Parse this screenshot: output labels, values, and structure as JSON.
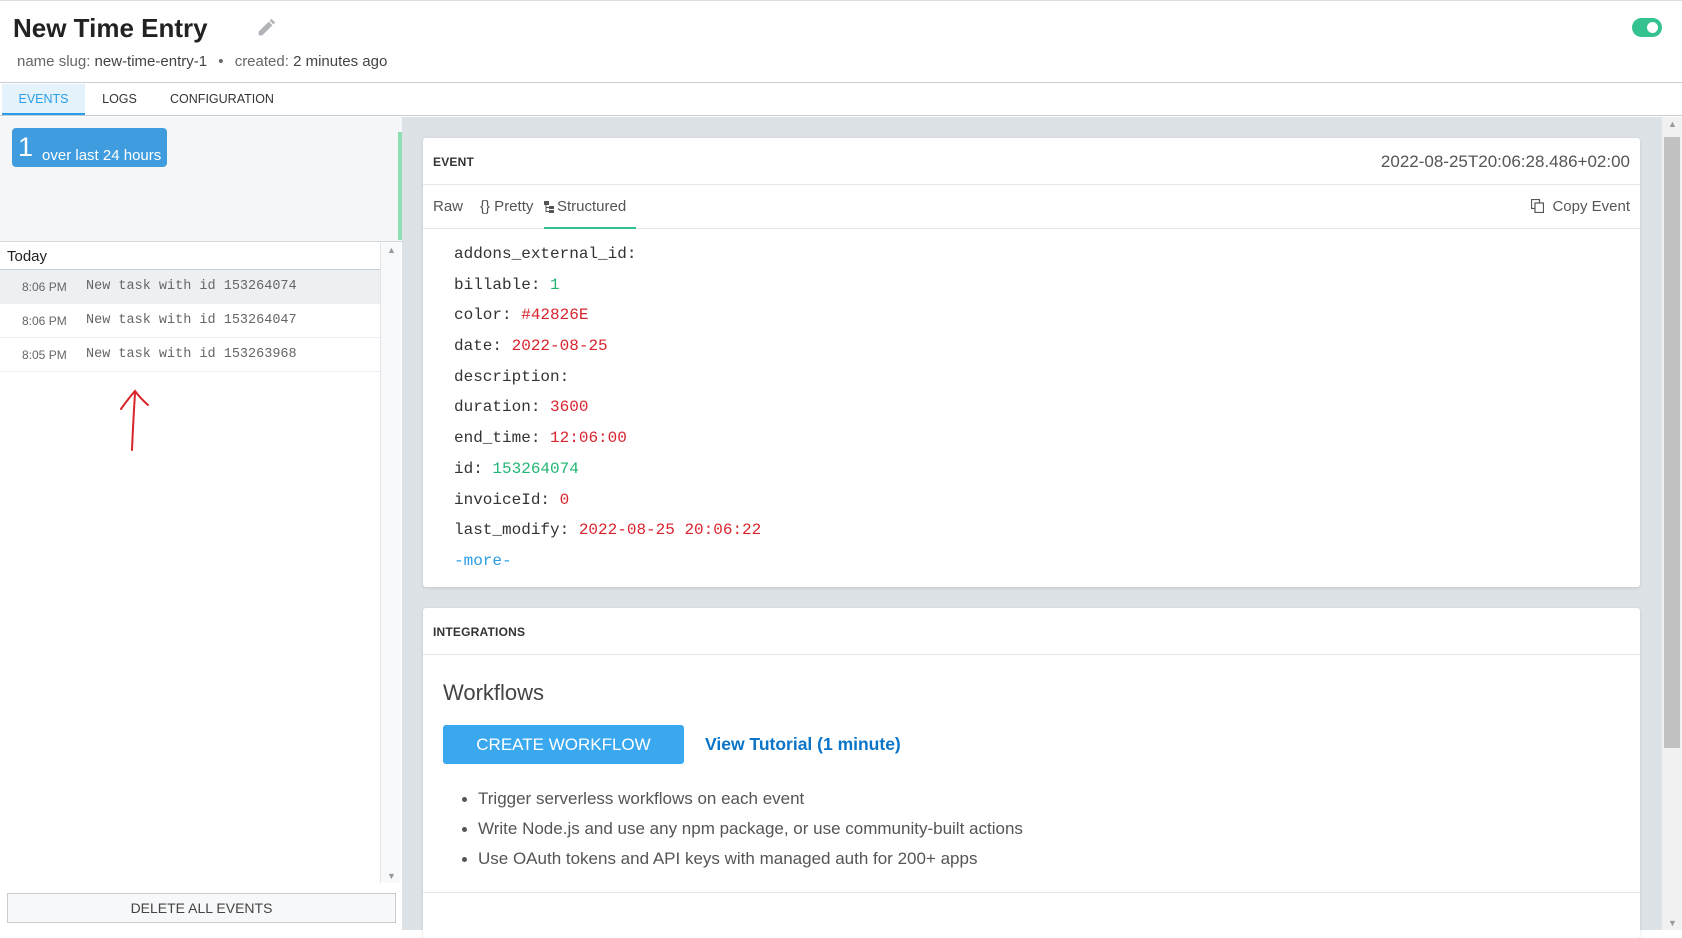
{
  "header": {
    "title": "New Time Entry",
    "slug_label": "name slug:",
    "slug_value": "new-time-entry-1",
    "separator": "•",
    "created_label": "created:",
    "created_value": "2 minutes ago",
    "toggle_on": true,
    "toggle_color": "#34c38f"
  },
  "tabs": [
    {
      "label": "EVENTS",
      "active": true
    },
    {
      "label": "LOGS",
      "active": false
    },
    {
      "label": "CONFIGURATION",
      "active": false
    }
  ],
  "stats": {
    "count": "1",
    "label": "over last 24 hours"
  },
  "event_list": {
    "group": "Today",
    "rows": [
      {
        "time": "8:06 PM",
        "desc": "New task with id 153264074",
        "selected": true
      },
      {
        "time": "8:06 PM",
        "desc": "New task with id 153264047",
        "selected": false
      },
      {
        "time": "8:05 PM",
        "desc": "New task with id 153263968",
        "selected": false
      }
    ],
    "delete_label": "DELETE ALL EVENTS"
  },
  "event_card": {
    "title": "EVENT",
    "timestamp": "2022-08-25T20:06:28.486+02:00",
    "subtabs": [
      {
        "label": "Raw",
        "active": false
      },
      {
        "label": "{} Pretty",
        "active": false
      },
      {
        "label": "Structured",
        "active": true
      }
    ],
    "copy_label": "Copy Event",
    "fields": [
      {
        "key": "addons_external_id:",
        "value": "",
        "color": ""
      },
      {
        "key": "billable:",
        "value": "1",
        "color": "green"
      },
      {
        "key": "color:",
        "value": "#42826E",
        "color": "red"
      },
      {
        "key": "date:",
        "value": "2022-08-25",
        "color": "red"
      },
      {
        "key": "description:",
        "value": "",
        "color": ""
      },
      {
        "key": "duration:",
        "value": "3600",
        "color": "red"
      },
      {
        "key": "end_time:",
        "value": "12:06:00",
        "color": "red"
      },
      {
        "key": "id:",
        "value": "153264074",
        "color": "green"
      },
      {
        "key": "invoiceId:",
        "value": "0",
        "color": "red"
      },
      {
        "key": "last_modify:",
        "value": "2022-08-25 20:06:22",
        "color": "red"
      }
    ],
    "more_label": "-more-"
  },
  "integrations": {
    "title": "INTEGRATIONS",
    "workflows_title": "Workflows",
    "create_label": "CREATE WORKFLOW",
    "tutorial_label": "View Tutorial (1 minute)",
    "bullets": [
      "Trigger serverless workflows on each event",
      "Write Node.js and use any npm package, or use community-built actions",
      "Use OAuth tokens and API keys with managed auth for 200+ apps"
    ]
  }
}
